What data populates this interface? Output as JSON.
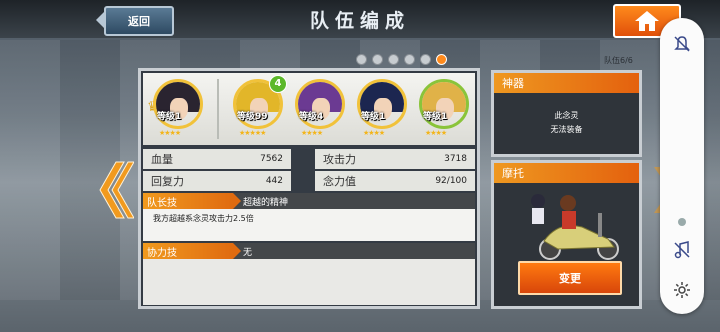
{
  "header": {
    "back_label": "返回",
    "title": "队伍编成"
  },
  "pager": {
    "pages": 6,
    "active_index": 5
  },
  "team_count": "队伍6/6",
  "heroes": [
    {
      "level": "等级1",
      "stars": "★★★★",
      "badge": "",
      "leader": true,
      "hair": "#2a2430"
    },
    {
      "level": "等级99",
      "stars": "★★★★★",
      "badge": "4",
      "leader": false,
      "hair": "#e2b629"
    },
    {
      "level": "等级4",
      "stars": "★★★★",
      "badge": "",
      "leader": false,
      "hair": "#6b3a92"
    },
    {
      "level": "等级1",
      "stars": "★★★★",
      "badge": "",
      "leader": false,
      "hair": "#1c2650"
    },
    {
      "level": "等级1",
      "stars": "★★★★",
      "badge": "",
      "leader": false,
      "hair": "#e0b248"
    }
  ],
  "stats": {
    "hp_label": "血量",
    "hp_value": "7562",
    "recovery_label": "回复力",
    "recovery_value": "442",
    "attack_label": "攻击力",
    "attack_value": "3718",
    "spirit_label": "念力值",
    "spirit_value": "92/100"
  },
  "leader_skill": {
    "tag": "队长技",
    "name": "超越的精神",
    "desc": "我方超越系念灵攻击力2.5倍"
  },
  "assist_skill": {
    "tag": "协力技",
    "name": "无"
  },
  "artifact": {
    "title": "神器",
    "line1": "此念灵",
    "line2": "无法装备"
  },
  "motorbike": {
    "title": "摩托",
    "change_label": "变更"
  },
  "colors": {
    "accent": "#e8700f",
    "panel": "#343b44"
  },
  "dock_icons": [
    "bell-off-icon",
    "music-off-icon",
    "gear-icon"
  ]
}
